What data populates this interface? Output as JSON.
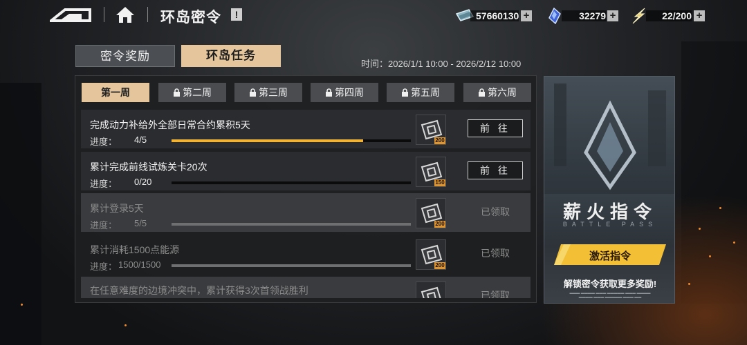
{
  "header": {
    "title": "环岛密令",
    "info_symbol": "!"
  },
  "resources": [
    {
      "icon": "banknote-icon",
      "value": "57660130"
    },
    {
      "icon": "crystal-icon",
      "value": "32279"
    },
    {
      "icon": "lightning-icon",
      "value": "22/200"
    }
  ],
  "resource_plus": "+",
  "main_tabs": {
    "rewards": "密令奖励",
    "tasks": "环岛任务",
    "selected": "tasks"
  },
  "time_range": "时间：2026/1/1 10:00 - 2026/2/12 10:00",
  "weeks": [
    "第一周",
    "第二周",
    "第三周",
    "第四周",
    "第五周",
    "第六周"
  ],
  "progress_label": "进度：",
  "tasks": [
    {
      "name": "完成动力补给外全部日常合约累积5天",
      "progress": "4/5",
      "fraction": 0.8,
      "reward": "200",
      "action": "前 往",
      "state": "active"
    },
    {
      "name": "累计完成前线试炼关卡20次",
      "progress": "0/20",
      "fraction": 0,
      "reward": "150",
      "action": "前 往",
      "state": "active"
    },
    {
      "name": "累计登录5天",
      "progress": "5/5",
      "fraction": 1,
      "reward": "200",
      "action": "已领取",
      "state": "claimed"
    },
    {
      "name": "累计消耗1500点能源",
      "progress": "1500/1500",
      "fraction": 1,
      "reward": "200",
      "action": "已领取",
      "state": "claimed"
    },
    {
      "name": "在任意难度的边境冲突中，累计获得3次首领战胜利",
      "action": "已领取",
      "state": "claimed"
    }
  ],
  "promo": {
    "title": "薪火指令",
    "subtitle": "BATTLE PASS",
    "button": "激活指令",
    "note": "解锁密令获取更多奖励!"
  },
  "colors": {
    "accent": "#e4c59c",
    "progress": "#f2b233",
    "reward_tag": "#e09630",
    "promo_button": "#f2bf35"
  }
}
